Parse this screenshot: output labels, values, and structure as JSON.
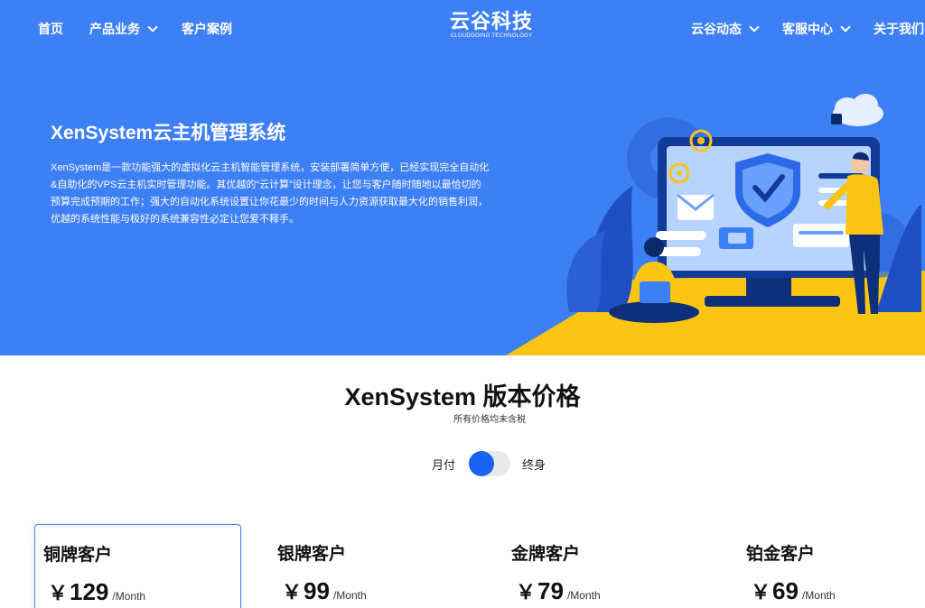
{
  "nav": {
    "left": [
      {
        "label": "首页",
        "has_dropdown": false
      },
      {
        "label": "产品业务",
        "has_dropdown": true
      },
      {
        "label": "客户案例",
        "has_dropdown": false
      }
    ],
    "right": [
      {
        "label": "云谷动态",
        "has_dropdown": true
      },
      {
        "label": "客服中心",
        "has_dropdown": true
      },
      {
        "label": "关于我们",
        "has_dropdown": false
      }
    ],
    "logo": {
      "main": "云谷科技",
      "sub": "CLOUDGOING TECHNOLOGY"
    }
  },
  "hero": {
    "title": "XenSystem云主机管理系统",
    "description": "XenSystem是一款功能强大的虚拟化云主机智能管理系统，安装部署简单方便，已经实现完全自动化&自助化的VPS云主机实时管理功能。其优越的“云计算”设计理念，让您与客户随时随地以最恰切的预算完成预期的工作；强大的自动化系统设置让你花最少的时间与人力资源获取最大化的销售利润，优越的系统性能与极好的系统兼容性必定让您爱不释手。"
  },
  "pricing": {
    "title": "XenSystem 版本价格",
    "subtitle": "所有价格均未含税",
    "toggle": {
      "left_label": "月付",
      "right_label": "终身",
      "state": "monthly"
    },
    "currency": "￥",
    "period": "/Month",
    "plans": [
      {
        "name": "铜牌客户",
        "price": "129"
      },
      {
        "name": "银牌客户",
        "price": "99"
      },
      {
        "name": "金牌客户",
        "price": "79"
      },
      {
        "name": "铂金客户",
        "price": "69"
      }
    ]
  },
  "colors": {
    "hero_blue": "#3d7ff5",
    "accent_yellow": "#f9c512",
    "toggle_blue": "#1764f5"
  }
}
